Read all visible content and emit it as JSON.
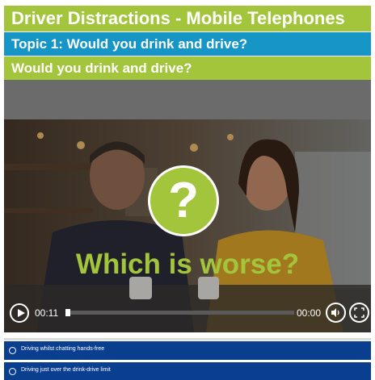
{
  "header": {
    "title": "Driver Distractions - Mobile Telephones",
    "topic": "Topic 1: Would you drink and drive?",
    "subtitle": "Would you drink and drive?"
  },
  "video": {
    "overlay_symbol": "?",
    "overlay_text": "Which is worse?",
    "current_time": "00:11",
    "duration": "00:00",
    "progress_fraction": 0.02,
    "icons": [
      "play-icon",
      "volume-icon",
      "fullscreen-icon"
    ]
  },
  "options": [
    {
      "label": "Driving whilst chatting hands-free"
    },
    {
      "label": "Driving just over the drink-drive limit"
    }
  ],
  "colors": {
    "brand_green": "#a3c53b",
    "brand_blue": "#1596c7",
    "option_blue": "#0a3f8f"
  }
}
